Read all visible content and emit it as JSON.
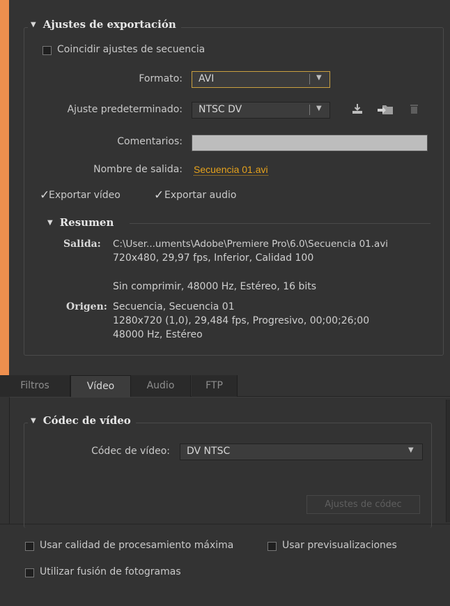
{
  "export_settings": {
    "section_title": "Ajustes de exportación",
    "match_sequence_label": "Coincidir ajustes de secuencia",
    "format_label": "Formato:",
    "format_value": "AVI",
    "preset_label": "Ajuste predeterminado:",
    "preset_value": "NTSC DV",
    "comments_label": "Comentarios:",
    "comments_value": "",
    "output_name_label": "Nombre de salida:",
    "output_name_value": "Secuencia 01.avi",
    "export_video_label": "Exportar vídeo",
    "export_audio_label": "Exportar audio"
  },
  "summary": {
    "title": "Resumen",
    "output_label": "Salida:",
    "output_lines": [
      "C:\\User...uments\\Adobe\\Premiere Pro\\6.0\\Secuencia 01.avi",
      "720x480, 29,97 fps, Inferior, Calidad 100",
      "Sin comprimir, 48000 Hz, Estéreo, 16 bits"
    ],
    "source_label": "Origen:",
    "source_lines": [
      "Secuencia, Secuencia 01",
      "1280x720 (1,0), 29,484 fps, Progresivo, 00;00;26;00",
      "48000 Hz, Estéreo"
    ]
  },
  "tabs": [
    {
      "label": "Filtros"
    },
    {
      "label": "Vídeo"
    },
    {
      "label": "Audio"
    },
    {
      "label": "FTP"
    }
  ],
  "video_codec": {
    "section_title": "Códec de vídeo",
    "codec_label": "Códec de vídeo:",
    "codec_value": "DV NTSC",
    "codec_settings_button": "Ajustes de códec"
  },
  "bottom_options": {
    "max_quality_label": "Usar calidad de procesamiento máxima",
    "use_previews_label": "Usar previsualizaciones",
    "frame_blending_label": "Utilizar fusión de fotogramas"
  },
  "icons": {
    "save_preset": "download-icon",
    "import_preset": "import-folder-icon",
    "delete_preset": "trash-icon"
  },
  "colors": {
    "accent_orange": "#ee8f4e",
    "panel_bg": "#333333",
    "link_yellow": "#e6a21c"
  }
}
